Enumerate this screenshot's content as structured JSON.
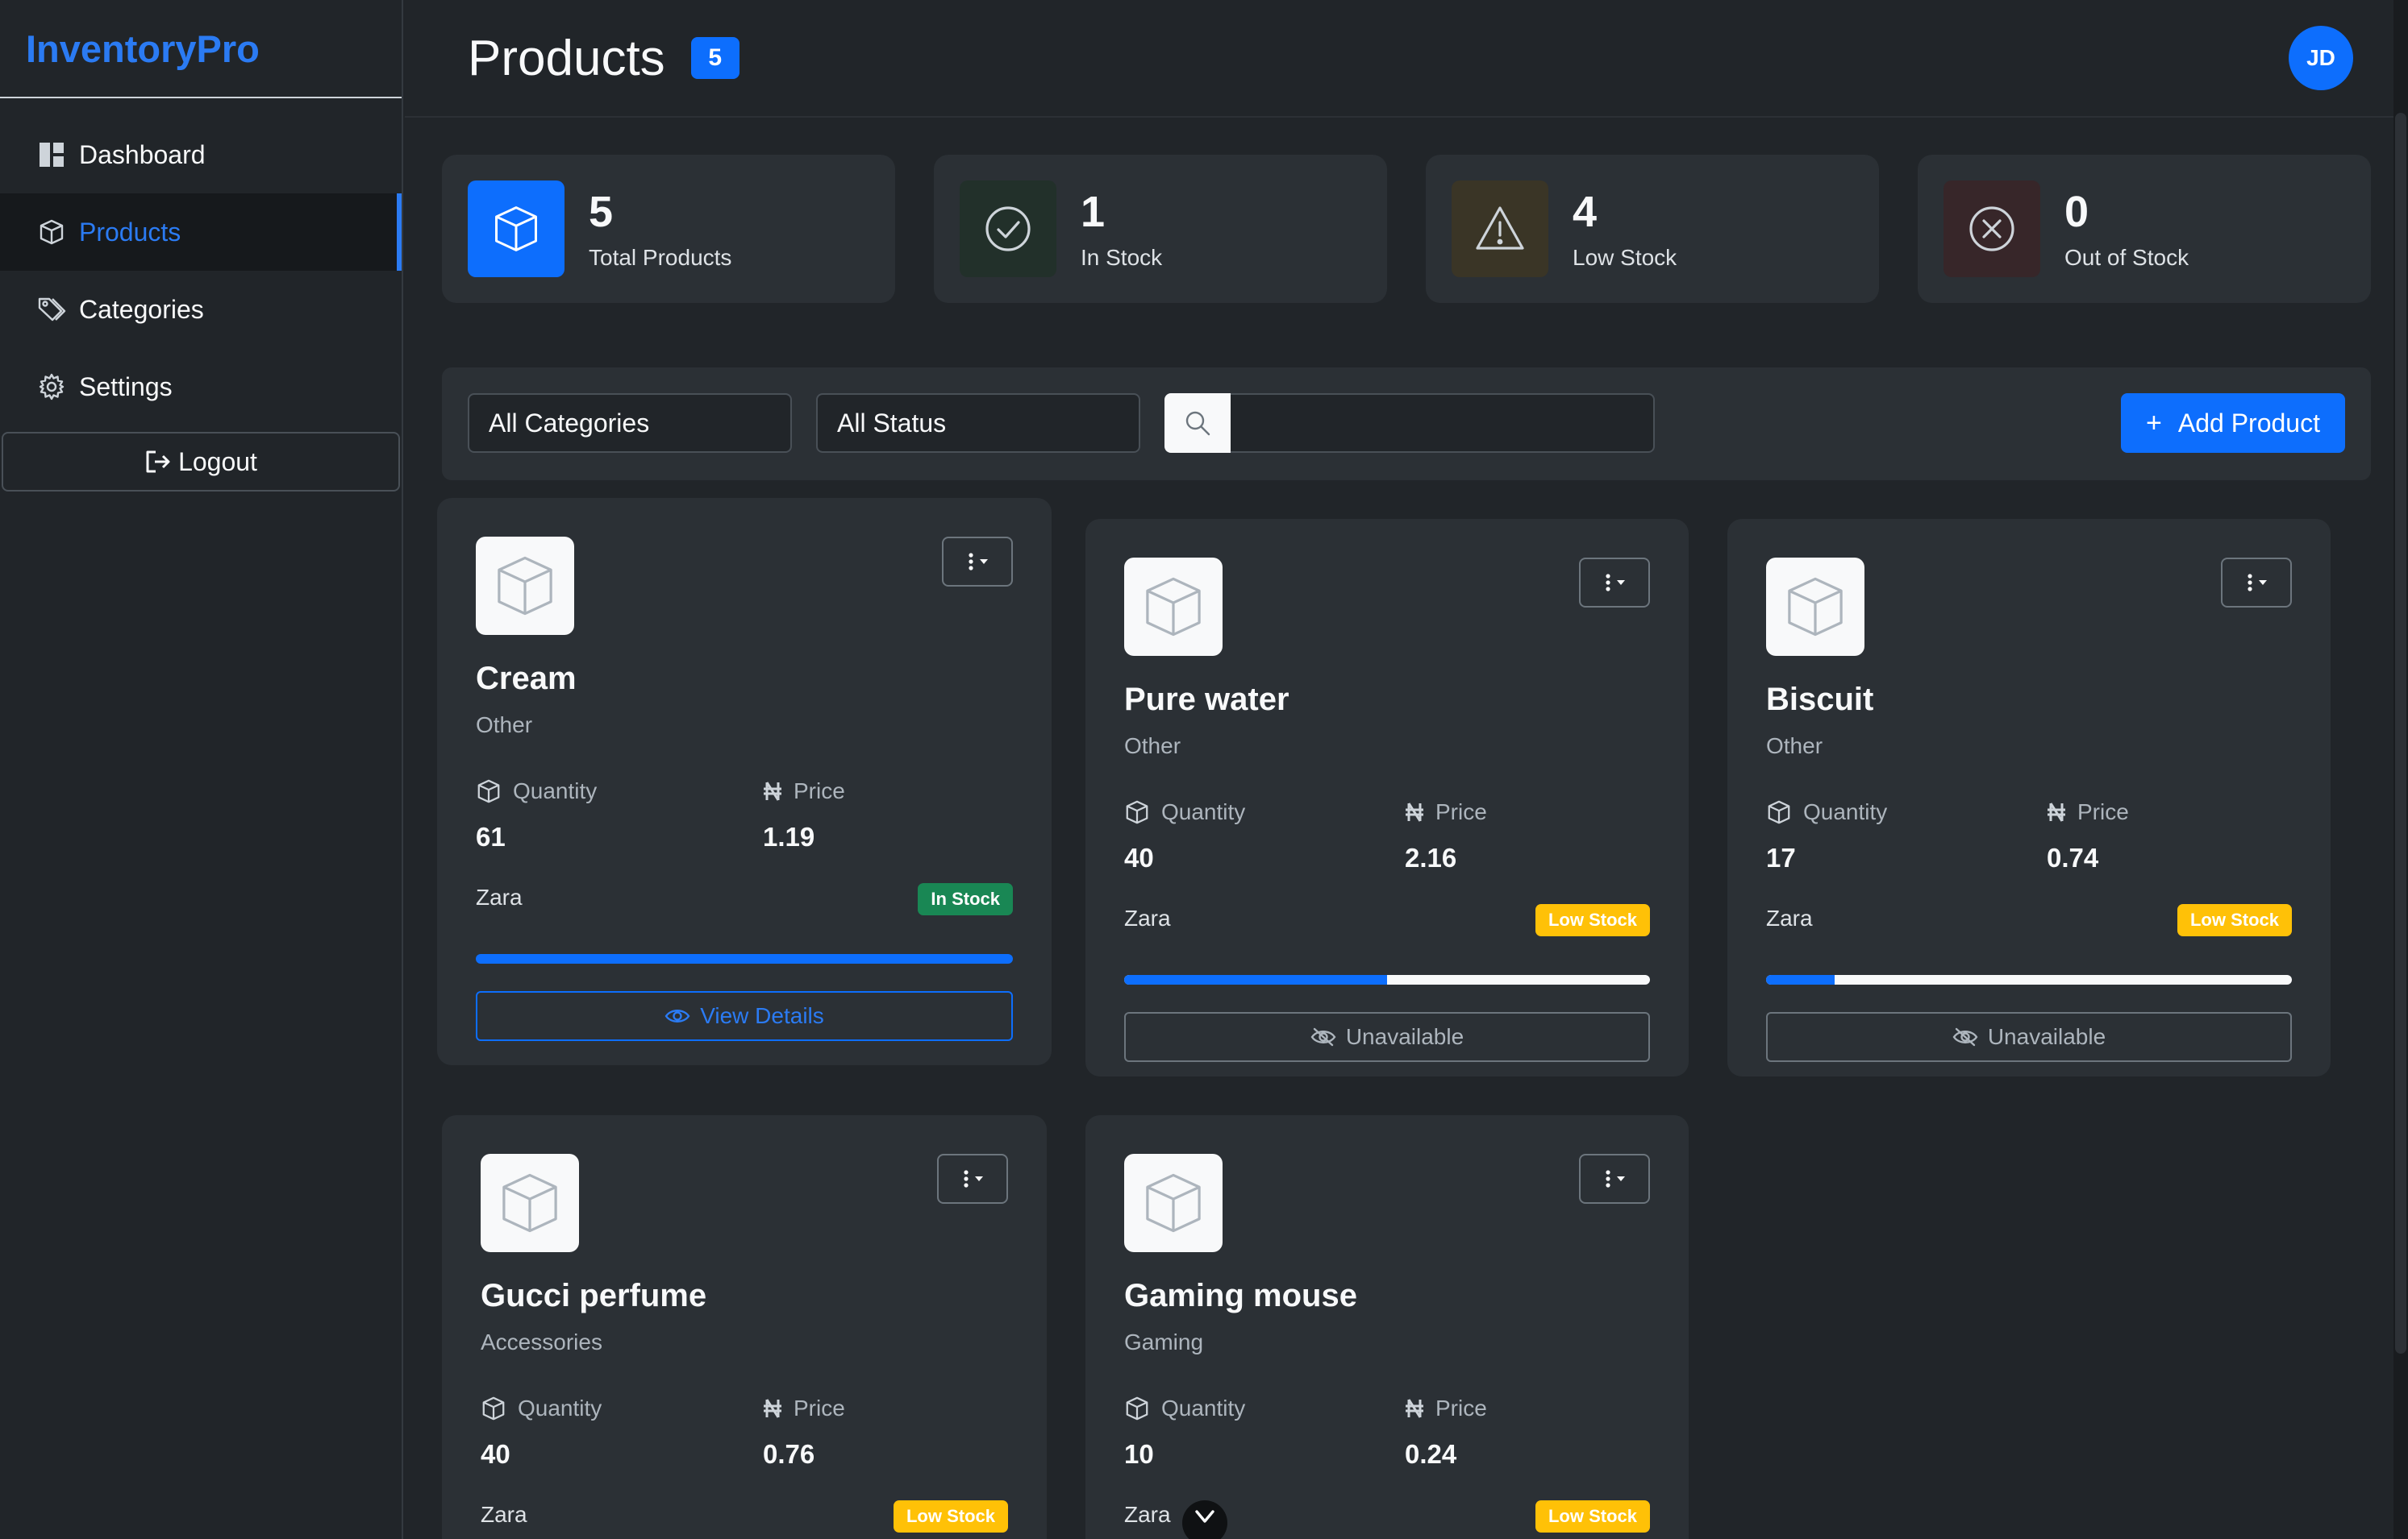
{
  "app": {
    "brand": "InventoryPro"
  },
  "sidebar": {
    "items": [
      {
        "label": "Dashboard",
        "icon": "dashboard-icon"
      },
      {
        "label": "Products",
        "icon": "box-icon",
        "active": true
      },
      {
        "label": "Categories",
        "icon": "tags-icon"
      },
      {
        "label": "Settings",
        "icon": "gear-icon"
      }
    ],
    "logout": "Logout"
  },
  "header": {
    "title": "Products",
    "count": "5",
    "avatar": "JD"
  },
  "stats": [
    {
      "value": "5",
      "label": "Total Products",
      "icon": "box-icon",
      "color": "#0d6efd"
    },
    {
      "value": "1",
      "label": "In Stock",
      "icon": "check-circle-icon",
      "color": "#198754"
    },
    {
      "value": "4",
      "label": "Low Stock",
      "icon": "warning-icon",
      "color": "#ffc107"
    },
    {
      "value": "0",
      "label": "Out of Stock",
      "icon": "x-circle-icon",
      "color": "#dc3545"
    }
  ],
  "filters": {
    "category": "All Categories",
    "status": "All Status",
    "search_value": "",
    "add_label": "Add Product"
  },
  "labels": {
    "quantity": "Quantity",
    "price": "Price"
  },
  "products": [
    {
      "name": "Cream",
      "category": "Other",
      "quantity": "61",
      "price": "1.19",
      "supplier": "Zara",
      "status": "In Stock",
      "stock_level": 1.0,
      "action": "View Details"
    },
    {
      "name": "Pure water",
      "category": "Other",
      "quantity": "40",
      "price": "2.16",
      "supplier": "Zara",
      "status": "Low Stock",
      "stock_level": 0.5,
      "action": "Unavailable"
    },
    {
      "name": "Biscuit",
      "category": "Other",
      "quantity": "17",
      "price": "0.74",
      "supplier": "Zara",
      "status": "Low Stock",
      "stock_level": 0.13,
      "action": "Unavailable"
    },
    {
      "name": "Gucci perfume",
      "category": "Accessories",
      "quantity": "40",
      "price": "0.76",
      "supplier": "Zara",
      "status": "Low Stock"
    },
    {
      "name": "Gaming mouse",
      "category": "Gaming",
      "quantity": "10",
      "price": "0.24",
      "supplier": "Zara",
      "status": "Low Stock"
    }
  ],
  "colors": {
    "accent": "#0d6efd",
    "success": "#198754",
    "warning": "#ffc107",
    "danger": "#dc3545",
    "background": "#212529",
    "card": "#2b3035"
  }
}
